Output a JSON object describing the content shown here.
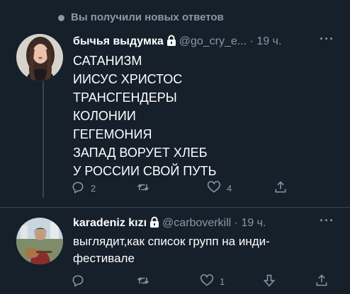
{
  "notice": {
    "text": "Вы получили новых ответов"
  },
  "tweets": [
    {
      "author": "бычья выдумка",
      "handle": "@go_cry_e...",
      "separator": "·",
      "time": "19 ч.",
      "more": "···",
      "lines": [
        "САТАНИЗМ",
        "ИИСУС ХРИСТОС",
        "ТРАНСГЕНДЕРЫ",
        "КОЛОНИИ",
        "ГЕГЕМОНИЯ",
        "ЗАПАД ВОРУЕТ ХЛЕБ",
        "У РОССИИ СВОЙ ПУТЬ"
      ],
      "replies": "2",
      "retweets": "",
      "likes": "4",
      "icons": [
        "reply-icon",
        "retweet-icon",
        "like-icon",
        "share-icon"
      ]
    },
    {
      "author": "karadeniz kızı",
      "handle": "@carboverkill",
      "separator": "·",
      "time": "19 ч.",
      "more": "···",
      "text": "выглядит,как список групп на инди-фестивале",
      "replies": "",
      "retweets": "",
      "likes": "1",
      "icons": [
        "reply-icon",
        "retweet-icon",
        "like-icon",
        "downvote-icon",
        "share-icon"
      ]
    }
  ],
  "colors": {
    "background": "#15202b",
    "text": "#ffffff",
    "muted": "#8899a6",
    "divider": "#38444d"
  }
}
